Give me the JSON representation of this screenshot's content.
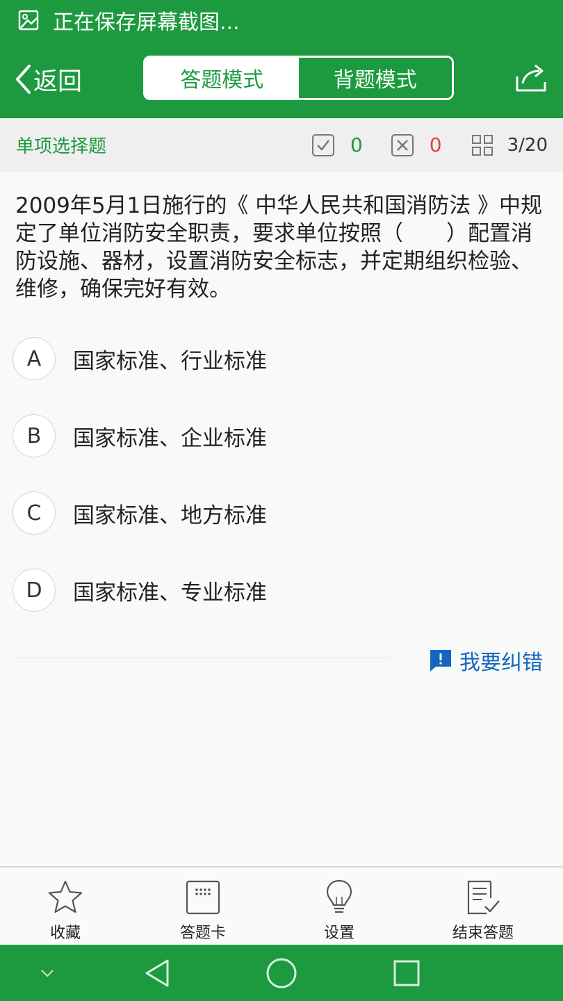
{
  "status_bar": {
    "notification": "正在保存屏幕截图..."
  },
  "header": {
    "back_label": "返回",
    "tabs": [
      {
        "label": "答题模式",
        "active": true
      },
      {
        "label": "背题模式",
        "active": false
      }
    ]
  },
  "subheader": {
    "question_type": "单项选择题",
    "correct_count": "0",
    "wrong_count": "0",
    "progress": "3/20"
  },
  "question": {
    "text": "2009年5月1日施行的《 中华人民共和国消防法 》中规定了单位消防安全职责，要求单位按照（　　）配置消防设施、器材，设置消防安全标志，并定期组织检验、维修，确保完好有效。",
    "options": [
      {
        "letter": "A",
        "text": "国家标准、行业标准"
      },
      {
        "letter": "B",
        "text": "国家标准、企业标准"
      },
      {
        "letter": "C",
        "text": "国家标准、地方标准"
      },
      {
        "letter": "D",
        "text": "国家标准、专业标准"
      }
    ]
  },
  "report_label": "我要纠错",
  "bottom_nav": [
    {
      "label": "收藏",
      "icon": "star-icon"
    },
    {
      "label": "答题卡",
      "icon": "answer-card-icon"
    },
    {
      "label": "设置",
      "icon": "lightbulb-icon"
    },
    {
      "label": "结束答题",
      "icon": "finish-list-icon"
    }
  ],
  "colors": {
    "primary": "#1d9a3f",
    "correct": "#1d9a3f",
    "wrong": "#e0453a",
    "link": "#1565c0"
  }
}
